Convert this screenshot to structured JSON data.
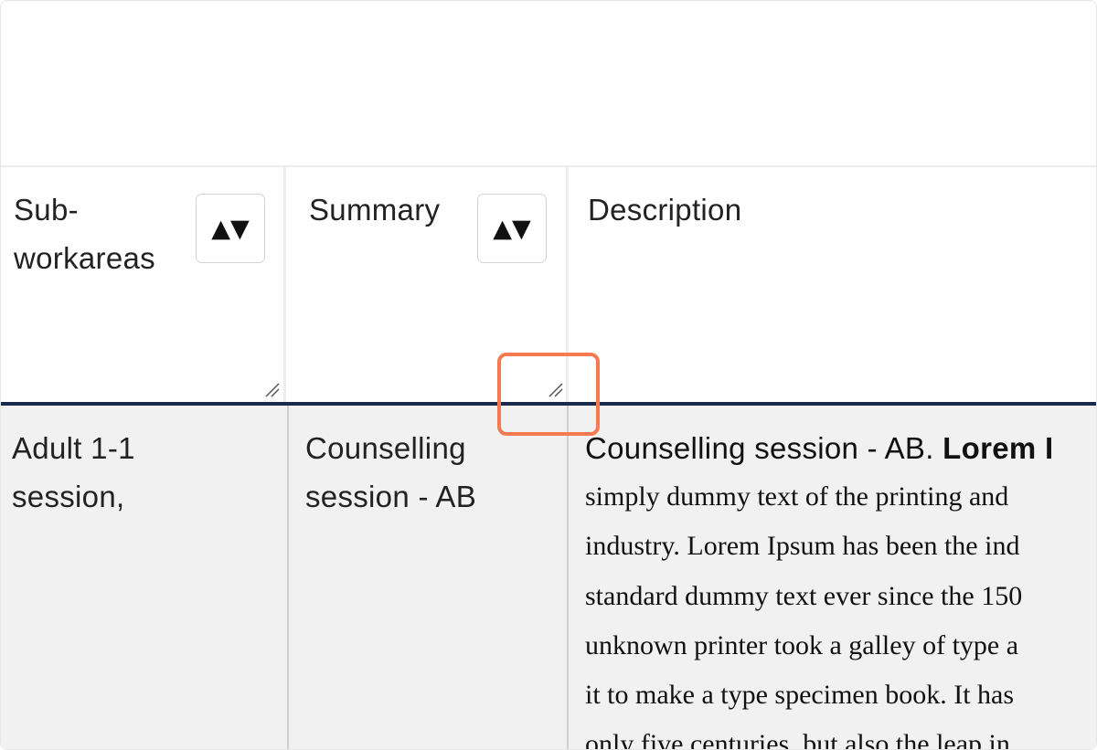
{
  "table": {
    "columns": [
      {
        "label": "Sub-\nworkareas",
        "sort_icon": "sort-up-down-icon",
        "sort_glyph": "▲▼"
      },
      {
        "label": "Summary",
        "sort_icon": "sort-up-down-icon",
        "sort_glyph": "▲▼"
      },
      {
        "label": "Description"
      }
    ],
    "rows": [
      {
        "subworkareas": "Adult 1-1\nsession,",
        "summary": "Counselling\nsession - AB",
        "description": {
          "first_line_plain": "Counselling session - AB. ",
          "first_line_bold": "Lorem I",
          "lines": [
            "simply dummy text of the printing and",
            "industry. Lorem Ipsum has been the ind",
            "standard dummy text ever since the 150",
            "unknown printer took a galley of type a",
            "it to make a type specimen book. It has",
            "only five centuries, but also the leap in"
          ]
        }
      }
    ]
  },
  "highlight": {
    "target": "summary-column-resize-handle",
    "color": "#f47a50"
  },
  "colors": {
    "header_separator": "#1b2a4a",
    "row_background": "#f1f1f1"
  }
}
